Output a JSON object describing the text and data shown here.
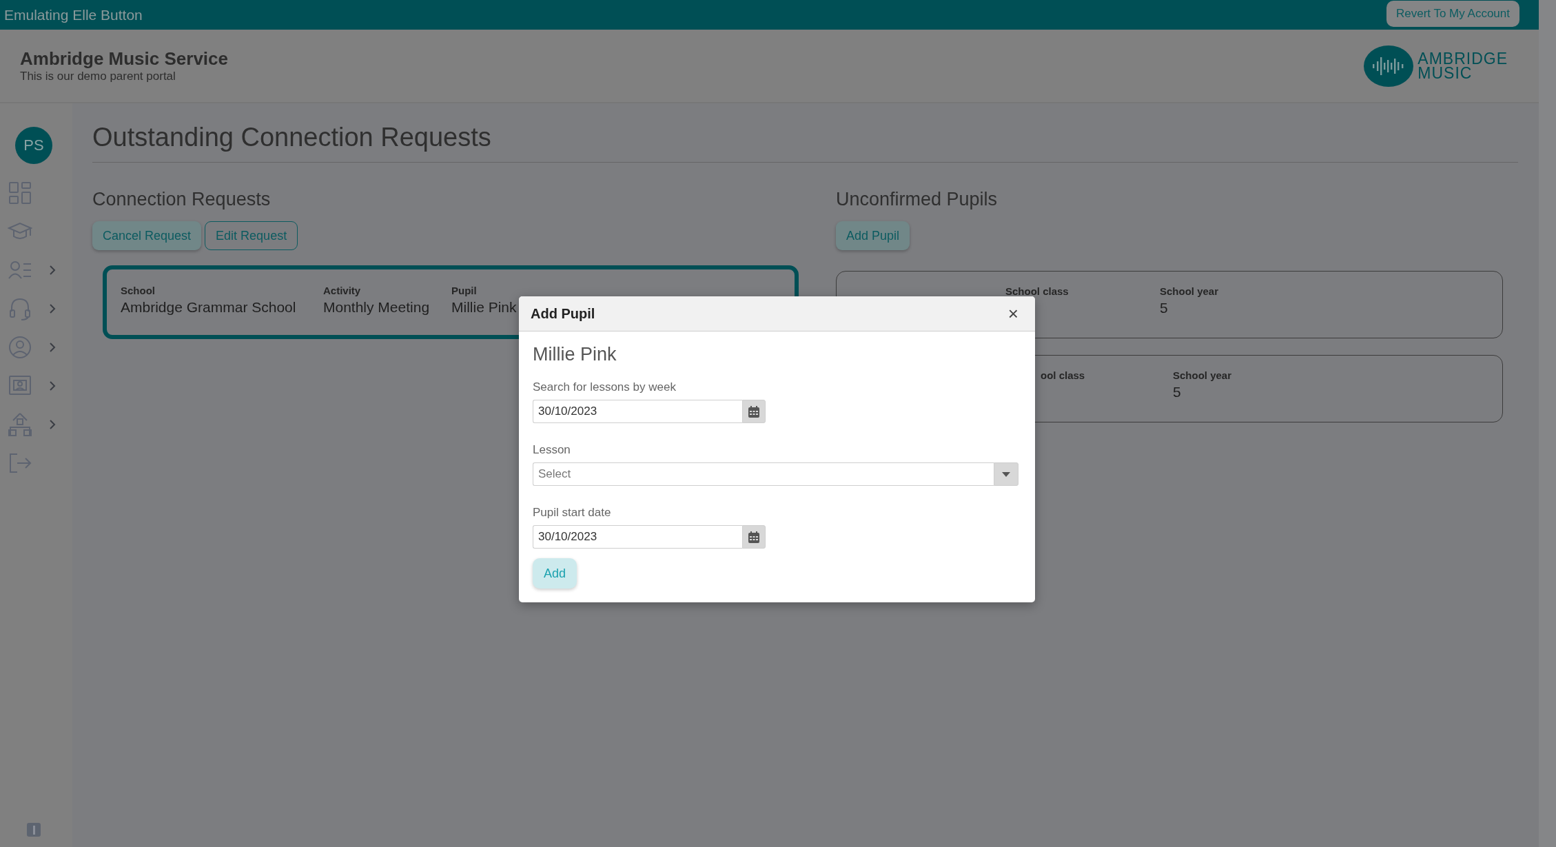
{
  "banner": {
    "text": "Emulating Elle Button",
    "button": "Revert To My Account"
  },
  "header": {
    "title": "Ambridge Music Service",
    "subtitle": "This is our demo parent portal",
    "logo_lines": [
      "AMBRIDGE",
      "MUSIC"
    ]
  },
  "sidebar": {
    "avatar": "PS",
    "items": [
      {
        "expandable": false
      },
      {
        "expandable": false
      },
      {
        "expandable": true
      },
      {
        "expandable": true
      },
      {
        "expandable": true
      },
      {
        "expandable": true
      },
      {
        "expandable": true
      },
      {
        "expandable": false
      }
    ]
  },
  "page_title": "Outstanding Connection Requests",
  "connection_requests": {
    "heading": "Connection Requests",
    "buttons": [
      {
        "label": "Cancel Request",
        "kind": "filled"
      },
      {
        "label": "Edit Request",
        "kind": "outline"
      }
    ],
    "cards": [
      {
        "selected": true,
        "fields": [
          {
            "label": "School",
            "value": "Ambridge Grammar School"
          },
          {
            "label": "Activity",
            "value": "Monthly Meeting"
          },
          {
            "label": "Pupil",
            "value": "Millie Pink"
          }
        ]
      }
    ]
  },
  "unconfirmed_pupils": {
    "heading": "Unconfirmed Pupils",
    "button": "Add Pupil",
    "cards": [
      {
        "selected": false,
        "fields": [
          {
            "label": "School class"
          },
          {
            "label": "School year",
            "value": "5"
          }
        ]
      },
      {
        "selected": false,
        "fields": [
          {
            "label": "ool class"
          },
          {
            "label": "School year",
            "value": "5"
          }
        ]
      }
    ]
  },
  "modal": {
    "title": "Add Pupil",
    "close": "×",
    "pupil_name": "Millie Pink",
    "fields": [
      {
        "kind": "date",
        "label": "Search for lessons by week",
        "value": "30/10/2023"
      },
      {
        "kind": "select",
        "label": "Lesson",
        "placeholder": "Select"
      },
      {
        "kind": "date",
        "label": "Pupil start date",
        "value": "30/10/2023"
      }
    ],
    "button": "Add"
  }
}
